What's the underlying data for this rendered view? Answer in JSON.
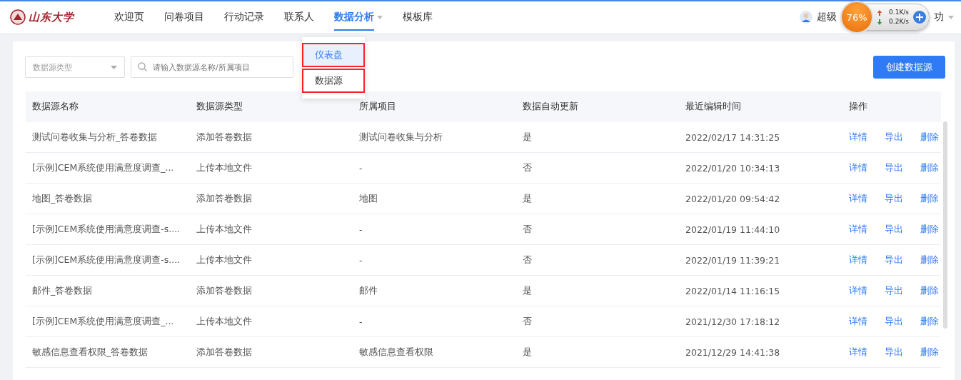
{
  "logo": {
    "text": "山东大学"
  },
  "nav": [
    {
      "label": "欢迎页",
      "selected": false,
      "has_menu": false
    },
    {
      "label": "问卷项目",
      "selected": false,
      "has_menu": false
    },
    {
      "label": "行动记录",
      "selected": false,
      "has_menu": false
    },
    {
      "label": "联系人",
      "selected": false,
      "has_menu": false
    },
    {
      "label": "数据分析",
      "selected": true,
      "has_menu": true
    },
    {
      "label": "模板库",
      "selected": false,
      "has_menu": false
    }
  ],
  "dropdown": {
    "items": [
      {
        "label": "仪表盘",
        "selected": true,
        "highlighted": true
      },
      {
        "label": "数据源",
        "selected": false,
        "highlighted": true
      }
    ]
  },
  "user": {
    "name_start": "超级",
    "name_end": "功"
  },
  "net_widget": {
    "percent": "76%",
    "up": "0.1K/s",
    "down": "0.2K/s"
  },
  "filters": {
    "type_select": {
      "placeholder": "数据源类型"
    },
    "search": {
      "placeholder": "请输入数据源名称/所属项目"
    }
  },
  "create_button": "创建数据源",
  "table": {
    "columns": [
      "数据源名称",
      "数据源类型",
      "所属项目",
      "数据自动更新",
      "最近编辑时间",
      "操作"
    ],
    "rows": [
      {
        "name": "测试问卷收集与分析_答卷数据",
        "type": "添加答卷数据",
        "project": "测试问卷收集与分析",
        "auto_update": "是",
        "time": "2022/02/17 14:31:25",
        "actions": [
          "详情",
          "导出",
          "删除"
        ]
      },
      {
        "name": "[示例]CEM系统使用满意度调查_...",
        "type": "上传本地文件",
        "project": "-",
        "auto_update": "否",
        "time": "2022/01/20 10:34:13",
        "actions": [
          "详情",
          "导出",
          "删除"
        ]
      },
      {
        "name": "地图_答卷数据",
        "type": "添加答卷数据",
        "project": "地图",
        "auto_update": "是",
        "time": "2022/01/20 09:54:42",
        "actions": [
          "详情",
          "导出",
          "删除"
        ]
      },
      {
        "name": "[示例]CEM系统使用满意度调查-s....",
        "type": "上传本地文件",
        "project": "-",
        "auto_update": "否",
        "time": "2022/01/19 11:44:10",
        "actions": [
          "详情",
          "导出",
          "删除"
        ]
      },
      {
        "name": "[示例]CEM系统使用满意度调查-s....",
        "type": "上传本地文件",
        "project": "-",
        "auto_update": "否",
        "time": "2022/01/19 11:39:21",
        "actions": [
          "详情",
          "导出",
          "删除"
        ]
      },
      {
        "name": "邮件_答卷数据",
        "type": "添加答卷数据",
        "project": "邮件",
        "auto_update": "是",
        "time": "2022/01/14 11:16:15",
        "actions": [
          "详情",
          "导出",
          "删除"
        ]
      },
      {
        "name": "[示例]CEM系统使用满意度调查_...",
        "type": "上传本地文件",
        "project": "-",
        "auto_update": "否",
        "time": "2021/12/30 17:18:12",
        "actions": [
          "详情",
          "导出",
          "删除"
        ]
      },
      {
        "name": "敏感信息查看权限_答卷数据",
        "type": "添加答卷数据",
        "project": "敏感信息查看权限",
        "auto_update": "是",
        "time": "2021/12/29 14:41:38",
        "actions": [
          "详情",
          "导出",
          "删除"
        ]
      }
    ]
  }
}
